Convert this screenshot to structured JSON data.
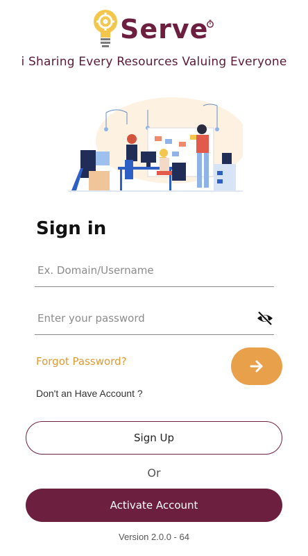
{
  "colors": {
    "brand": "#6d1f40",
    "accent": "#e9a04a",
    "forgot_link": "#e09a32"
  },
  "brand": {
    "name": "Serve",
    "tagline": "i Sharing Every Resources Valuing Everyone",
    "logo_icon": "lightbulb-gear-icon",
    "badge_icon": "timer-icon"
  },
  "illustration": {
    "icon": "office-team-illustration"
  },
  "signin": {
    "title": "Sign in",
    "username_placeholder": "Ex. Domain/Username",
    "username_value": "",
    "password_placeholder": "Enter your password",
    "password_value": "",
    "password_toggle_icon": "eye-off-icon",
    "forgot_password": "Forgot Password?",
    "submit_icon": "arrow-right-icon",
    "no_account_text": "Don't an Have Account ?"
  },
  "actions": {
    "signup_label": "Sign Up",
    "or_label": "Or",
    "activate_label": "Activate Account"
  },
  "footer": {
    "version": "Version 2.0.0 - 64"
  }
}
